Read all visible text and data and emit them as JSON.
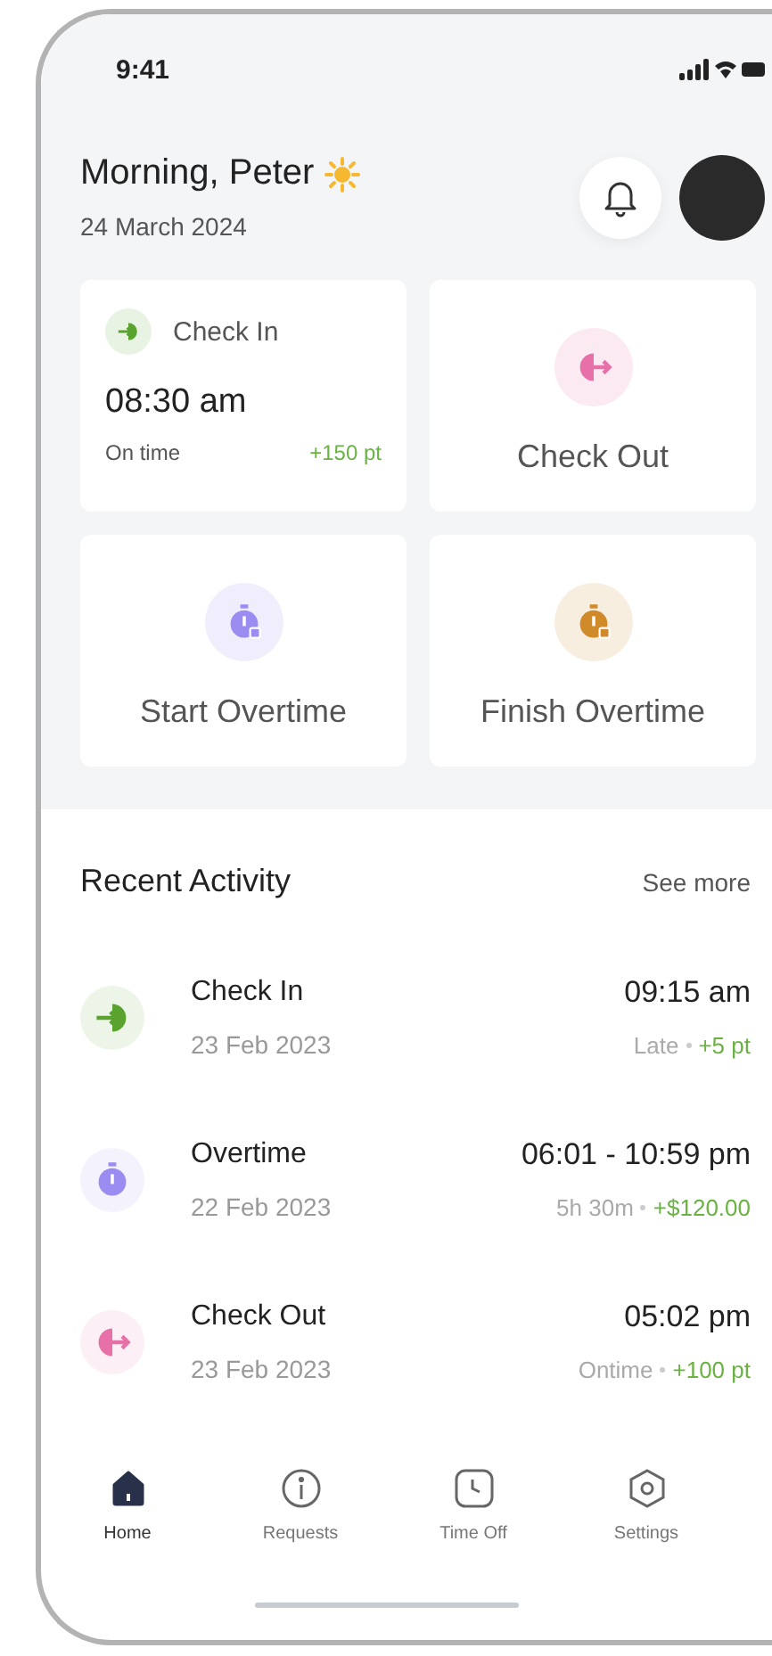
{
  "status_bar": {
    "time": "9:41"
  },
  "header": {
    "greeting": "Morning, Peter",
    "date": "24 March 2024"
  },
  "quick_actions": [
    {
      "kind": "check-in",
      "label": "Check In",
      "color": "#5aa32f",
      "time": "08:30 am",
      "note": "On time",
      "points": "+150 pt"
    },
    {
      "kind": "check-out",
      "label": "Check Out",
      "color": "#e870a8"
    },
    {
      "kind": "overtime",
      "label": "Start Overtime",
      "color": "#9a8cf0"
    },
    {
      "kind": "overtime",
      "label": "Finish Overtime",
      "color": "#d08a2a"
    }
  ],
  "recent_activity": {
    "title": "Recent Activity",
    "see_more": "See more",
    "items": [
      {
        "title": "Check In",
        "date": "23 Feb 2023",
        "time": "09:15 am",
        "status": "Late",
        "reward": "+5 pt",
        "kind": "check-in",
        "color": "#5aa32f"
      },
      {
        "title": "Overtime",
        "date": "22 Feb 2023",
        "time": "06:01 - 10:59 pm",
        "status": "5h 30m",
        "reward": "+$120.00",
        "kind": "overtime",
        "color": "#9a8cf0"
      },
      {
        "title": "Check Out",
        "date": "23 Feb 2023",
        "time": "05:02 pm",
        "status": "Ontime",
        "reward": "+100 pt",
        "kind": "check-out",
        "color": "#e870a8"
      }
    ]
  },
  "tab_bar": [
    {
      "label": "Home",
      "kind": "home",
      "selected": true
    },
    {
      "label": "Requests",
      "kind": "requests",
      "selected": false
    },
    {
      "label": "Time Off",
      "kind": "time-off",
      "selected": false
    },
    {
      "label": "Settings",
      "kind": "settings",
      "selected": false
    }
  ]
}
